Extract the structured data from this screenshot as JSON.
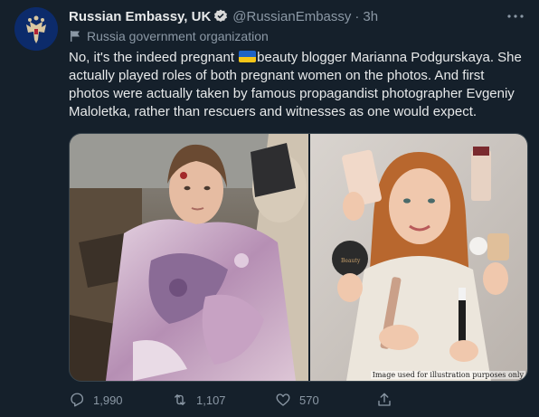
{
  "tweet": {
    "display_name": "Russian Embassy, UK",
    "handle": "@RussianEmbassy",
    "separator": "·",
    "time": "3h",
    "label": "Russia government organization",
    "text_before_flag": "No, it's the indeed pregnant ",
    "text_after_flag": "beauty blogger Marianna Podgurskaya. She actually played roles of both pregnant women on the photos. And first photos were actually taken by famous propagandist photographer Evgeniy Maloletka, rather than rescuers and witnesses as one would expect.",
    "media": {
      "right_photo_watermark": "Image used for illustration purposes only",
      "product_label": "Beauty"
    },
    "stats": {
      "replies": "1,990",
      "retweets": "1,107",
      "likes": "570"
    }
  },
  "icons": {
    "verified": "verified-badge-icon",
    "more": "more-icon",
    "label": "government-flag-icon",
    "reply": "reply-icon",
    "retweet": "retweet-icon",
    "like": "heart-icon",
    "share": "share-icon"
  },
  "colors": {
    "background": "#15202b",
    "primary_text": "#e7e9ea",
    "secondary_text": "#8b98a5",
    "verified_blue": "#1d9bf0",
    "border": "#38444d"
  }
}
